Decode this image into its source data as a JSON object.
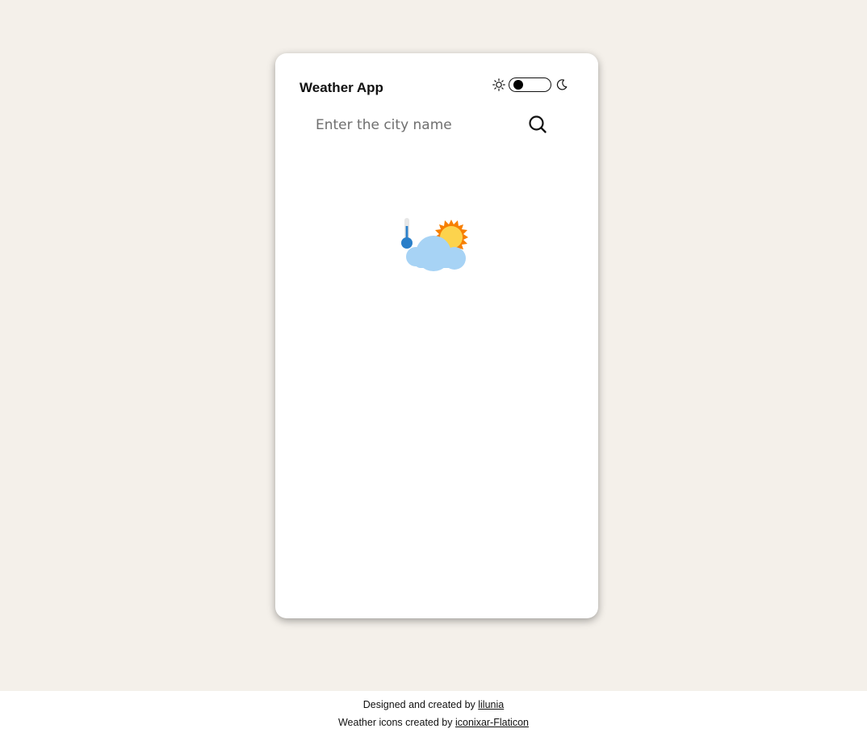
{
  "app": {
    "title": "Weather App"
  },
  "theme_toggle": {
    "light_icon": "sun-icon",
    "dark_icon": "moon-icon",
    "mode": "light"
  },
  "search": {
    "placeholder": "Enter the city name",
    "value": "",
    "button_icon": "search-icon"
  },
  "illustration": {
    "icon": "weather-partly-cloudy-thermometer-icon"
  },
  "footer": {
    "credit_prefix": "Designed and created by",
    "credit_link": "lilunia",
    "icons_prefix": "Weather icons created by",
    "icons_link": "iconixar-Flaticon"
  },
  "colors": {
    "page_background": "#f4f0ea",
    "card_background": "#ffffff",
    "sun_orange": "#f77f00",
    "sun_yellow": "#fcd34d",
    "cloud_blue": "#a7d3f5",
    "thermometer_blue": "#2a7fc9"
  }
}
